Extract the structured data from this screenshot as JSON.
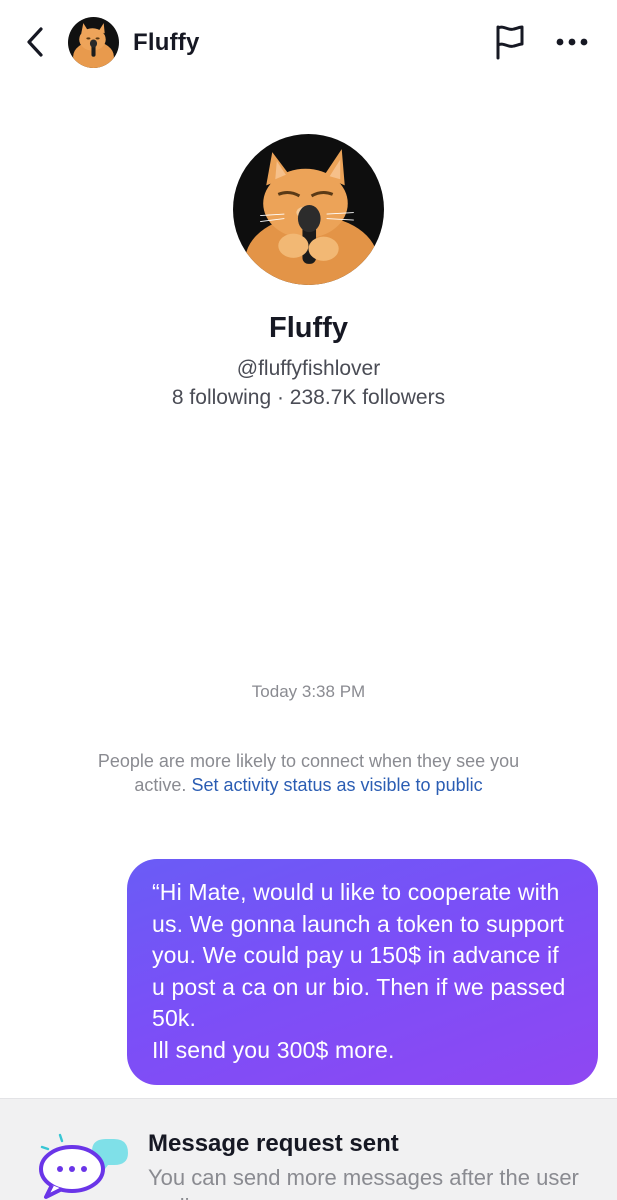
{
  "header": {
    "title": "Fluffy",
    "icons": {
      "back": "chevron-left-icon",
      "report": "flag-icon",
      "more": "more-dots-icon"
    }
  },
  "profile": {
    "name": "Fluffy",
    "handle": "@fluffyfishlover",
    "stats": "8 following · 238.7K followers"
  },
  "chat": {
    "timestamp": "Today 3:38 PM",
    "notice_text": "People are more likely to connect when they see you active.",
    "notice_link": "Set activity status as visible to public",
    "messages": [
      {
        "sender": "me",
        "text": "“Hi Mate, would u like to cooperate with us. We gonna launch a token to support you. We could pay u 150$ in advance if u post a ca on ur bio. Then if we passed 50k.\nIll send you 300$ more."
      }
    ]
  },
  "banner": {
    "title": "Message request sent",
    "subtitle": "You can send more messages after the user replies."
  },
  "colors": {
    "bubble_start": "#6a5cf6",
    "bubble_end": "#8f47f2",
    "link": "#2b5db3",
    "muted_text": "#8a8b91"
  }
}
